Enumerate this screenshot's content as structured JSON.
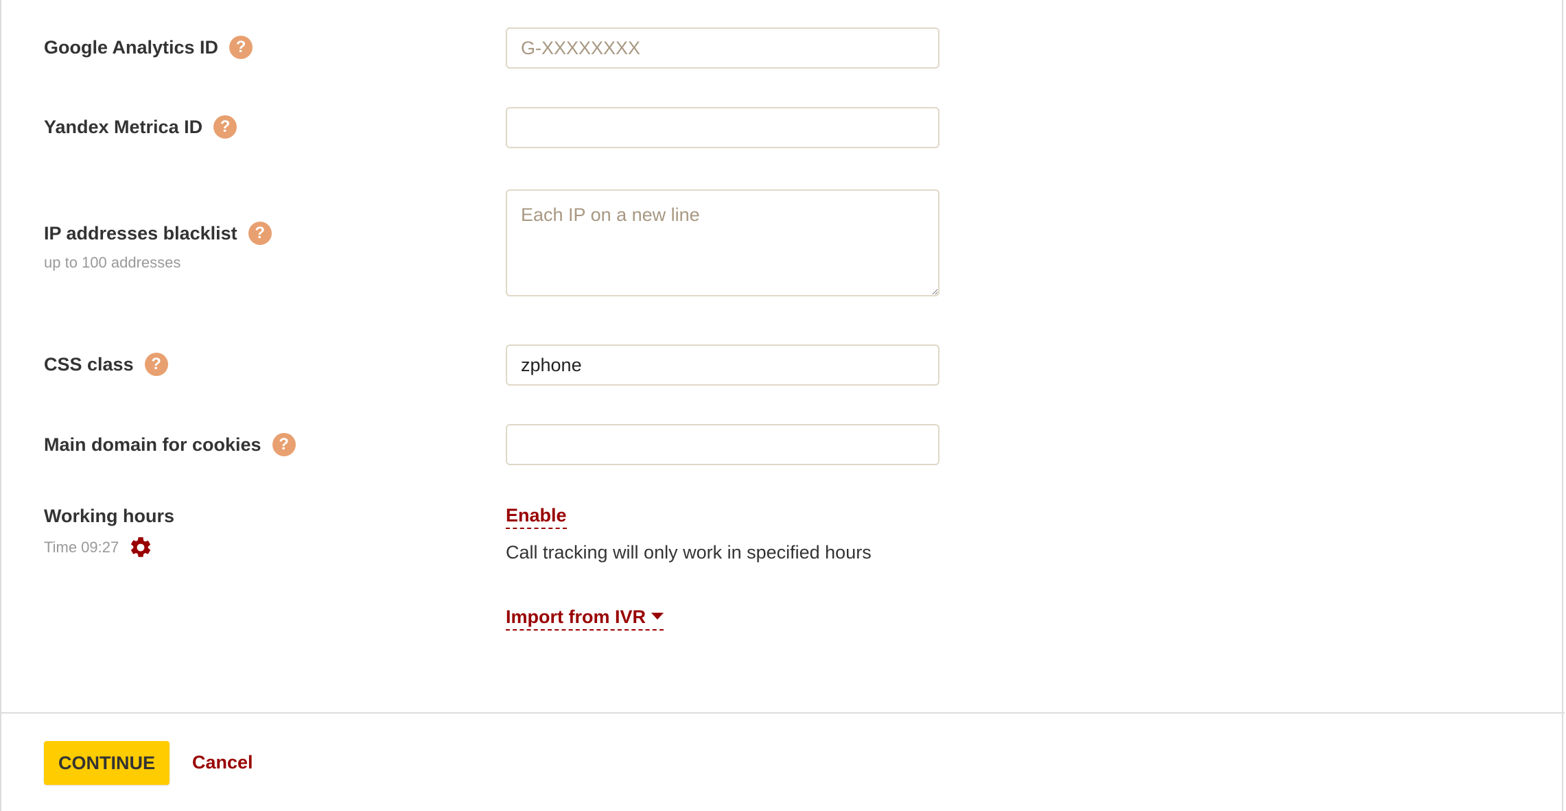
{
  "fields": {
    "ga": {
      "label": "Google Analytics ID",
      "placeholder": "G-XXXXXXXX",
      "value": ""
    },
    "yandex": {
      "label": "Yandex Metrica ID",
      "placeholder": "",
      "value": ""
    },
    "ip_blacklist": {
      "label": "IP addresses blacklist",
      "sublabel": "up to 100 addresses",
      "placeholder": "Each IP on a new line",
      "value": ""
    },
    "css_class": {
      "label": "CSS class",
      "value": "zphone"
    },
    "cookie_domain": {
      "label": "Main domain for cookies",
      "placeholder": "",
      "value": ""
    }
  },
  "help_icon_glyph": "?",
  "working_hours": {
    "label": "Working hours",
    "time_text": "Time 09:27",
    "enable_link": "Enable",
    "description": "Call tracking will only work in specified hours",
    "import_link": "Import from IVR"
  },
  "footer": {
    "continue_label": "CONTINUE",
    "cancel_label": "Cancel"
  },
  "icons": {
    "help": "question-circle-icon",
    "gear": "gear-icon",
    "caret": "caret-down-icon"
  },
  "colors": {
    "accent_link": "#990000",
    "help_icon": "#e8a070",
    "primary_button": "#ffcc00",
    "placeholder": "#a89882"
  }
}
